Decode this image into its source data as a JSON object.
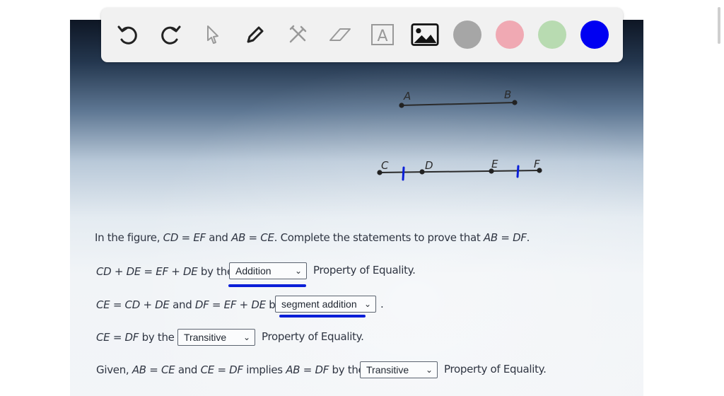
{
  "toolbar": {
    "tools": [
      {
        "icon": "undo-icon"
      },
      {
        "icon": "redo-icon"
      },
      {
        "icon": "pointer-icon"
      },
      {
        "icon": "pen-icon"
      },
      {
        "icon": "tools-icon"
      },
      {
        "icon": "eraser-icon"
      },
      {
        "icon": "text-icon",
        "glyph": "A"
      },
      {
        "icon": "image-icon"
      }
    ],
    "colors": [
      "#a6a6a6",
      "#f0a9b3",
      "#b8dbb1",
      "#0000f2"
    ]
  },
  "figure": {
    "segment_ab": {
      "labels": [
        "A",
        "B"
      ]
    },
    "segment_cf": {
      "labels": [
        "C",
        "D",
        "E",
        "F"
      ]
    }
  },
  "problem": {
    "intro": {
      "prefix": "In the figure, ",
      "eq1": "CD",
      "eq1b": " = ",
      "eq1c": "EF",
      "and": " and ",
      "eq2": "AB",
      "eq2b": " = ",
      "eq2c": "CE",
      "rest": ". Complete the statements to prove that ",
      "eq3": "AB",
      "eq3b": " = ",
      "eq3c": "DF",
      "end": "."
    },
    "s1": {
      "math": "CD + DE = EF + DE",
      "mid": " by the",
      "select": "Addition",
      "after": "Property of Equality."
    },
    "s2": {
      "math1": "CE = CD + DE",
      "and": " and ",
      "math2": "DF = EF + DE",
      "mid": " by",
      "select": "segment addition",
      "after": "."
    },
    "s3": {
      "math": "CE = DF",
      "mid": " by the",
      "select": "Transitive",
      "after": "Property of Equality."
    },
    "s4": {
      "pre": "Given, ",
      "math1": "AB = CE",
      "and": " and ",
      "math2": "CE = DF",
      "mid1": " implies ",
      "math3": "AB = DF",
      "mid2": " by the",
      "select": "Transitive",
      "after": "Property of Equality."
    }
  },
  "chevron": "⌄"
}
